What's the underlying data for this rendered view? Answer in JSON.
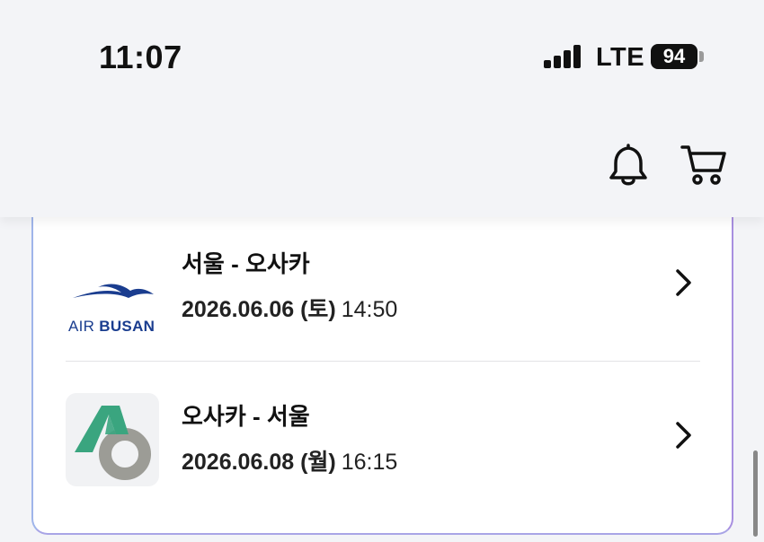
{
  "status_bar": {
    "time": "11:07",
    "network": "LTE",
    "battery": "94"
  },
  "header": {
    "icons": [
      "bell-icon",
      "cart-icon"
    ]
  },
  "flights": [
    {
      "airline_logo": "airbusan-logo",
      "logo_text_prefix": "AIR",
      "logo_text_main": "BUSAN",
      "route": "서울 - 오사카",
      "date": "2026.06.06 (토)",
      "time": "14:50"
    },
    {
      "airline_logo": "asiana-style-a-logo",
      "route": "오사카 - 서울",
      "date": "2026.06.08 (월)",
      "time": "16:15"
    }
  ],
  "colors": {
    "card_border_start": "#9fb5ea",
    "card_border_end": "#a88fe0",
    "airbusan_blue": "#1a3d8f",
    "logo_green": "#3aa57f",
    "logo_gray": "#9c9c96"
  }
}
